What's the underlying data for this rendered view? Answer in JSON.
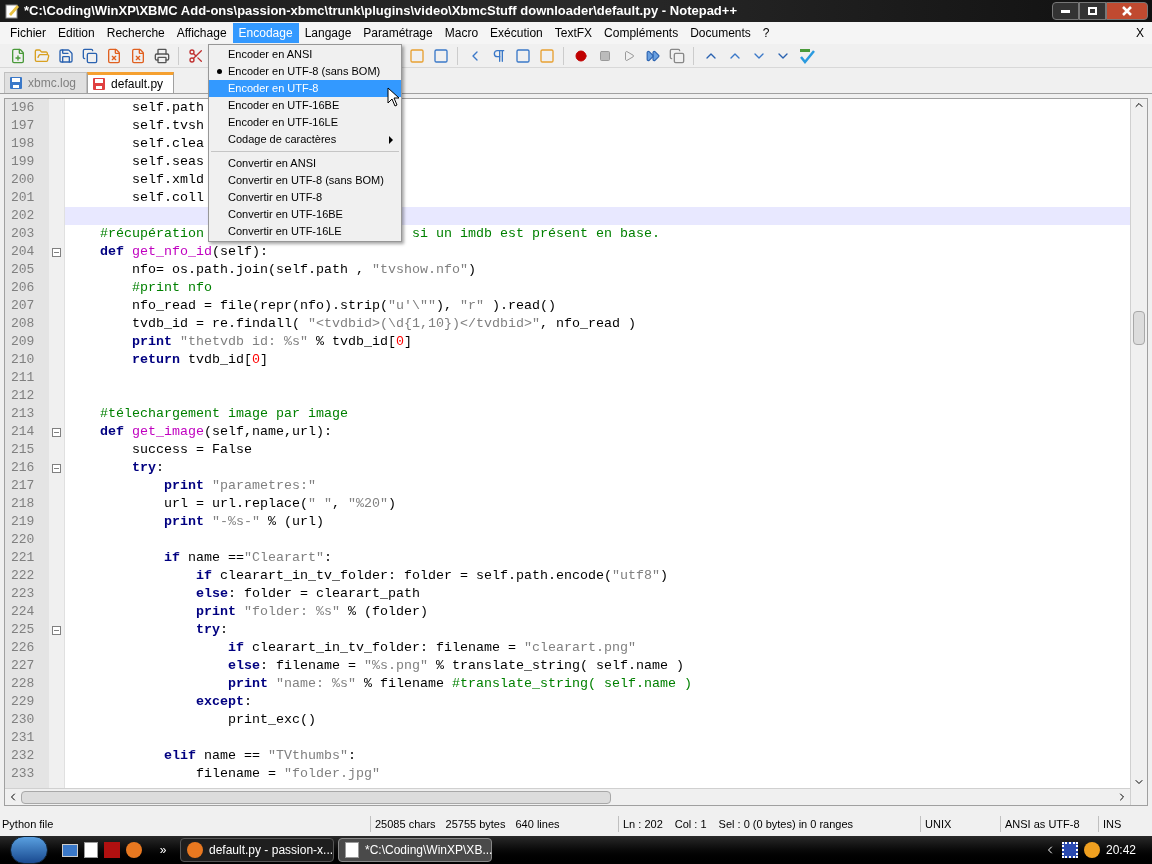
{
  "window": {
    "title": "*C:\\Coding\\WinXP\\XBMC Add-ons\\passion-xbmc\\trunk\\plugins\\video\\XbmcStuff downloader\\default.py - Notepad++"
  },
  "menu_bar": {
    "items": [
      {
        "label": "Fichier",
        "selected": false
      },
      {
        "label": "Edition",
        "selected": false
      },
      {
        "label": "Recherche",
        "selected": false
      },
      {
        "label": "Affichage",
        "selected": false
      },
      {
        "label": "Encodage",
        "selected": true
      },
      {
        "label": "Langage",
        "selected": false
      },
      {
        "label": "Paramétrage",
        "selected": false
      },
      {
        "label": "Macro",
        "selected": false
      },
      {
        "label": "Exécution",
        "selected": false
      },
      {
        "label": "TextFX",
        "selected": false
      },
      {
        "label": "Compléments",
        "selected": false
      },
      {
        "label": "Documents",
        "selected": false
      },
      {
        "label": "?",
        "selected": false
      }
    ],
    "close": "X"
  },
  "dropdown": {
    "items": [
      {
        "kind": "item",
        "label": "Encoder en ANSI",
        "checked": false,
        "selected": false
      },
      {
        "kind": "item",
        "label": "Encoder en UTF-8 (sans BOM)",
        "checked": true,
        "selected": false
      },
      {
        "kind": "item",
        "label": "Encoder en UTF-8",
        "checked": false,
        "selected": true
      },
      {
        "kind": "item",
        "label": "Encoder en UTF-16BE",
        "checked": false,
        "selected": false
      },
      {
        "kind": "item",
        "label": "Encoder en UTF-16LE",
        "checked": false,
        "selected": false
      },
      {
        "kind": "submenu",
        "label": "Codage de caractères",
        "checked": false,
        "selected": false
      },
      {
        "kind": "separator"
      },
      {
        "kind": "item",
        "label": "Convertir en ANSI",
        "checked": false,
        "selected": false
      },
      {
        "kind": "item",
        "label": "Convertir en UTF-8 (sans BOM)",
        "checked": false,
        "selected": false
      },
      {
        "kind": "item",
        "label": "Convertir en UTF-8",
        "checked": false,
        "selected": false
      },
      {
        "kind": "item",
        "label": "Convertir en UTF-16BE",
        "checked": false,
        "selected": false
      },
      {
        "kind": "item",
        "label": "Convertir en UTF-16LE",
        "checked": false,
        "selected": false
      }
    ]
  },
  "tabs": [
    {
      "label": "xbmc.log",
      "selected": false,
      "modified": false
    },
    {
      "label": "default.py",
      "selected": true,
      "modified": true
    }
  ],
  "editor": {
    "lines": [
      {
        "num": "196",
        "current": false,
        "fold": false,
        "tokens": [
          {
            "kind": "plain",
            "text": "        self.path"
          }
        ]
      },
      {
        "num": "197",
        "current": false,
        "fold": false,
        "tokens": [
          {
            "kind": "plain",
            "text": "        self.tvsh"
          }
        ]
      },
      {
        "num": "198",
        "current": false,
        "fold": false,
        "tokens": [
          {
            "kind": "plain",
            "text": "        self.clea"
          }
        ]
      },
      {
        "num": "199",
        "current": false,
        "fold": false,
        "tokens": [
          {
            "kind": "plain",
            "text": "        self.seas"
          }
        ]
      },
      {
        "num": "200",
        "current": false,
        "fold": false,
        "tokens": [
          {
            "kind": "plain",
            "text": "        self.xmld"
          }
        ]
      },
      {
        "num": "201",
        "current": false,
        "fold": false,
        "tokens": [
          {
            "kind": "plain",
            "text": "        self.coll"
          }
        ]
      },
      {
        "num": "202",
        "current": true,
        "fold": false
      },
      {
        "num": "203",
        "current": false,
        "fold": false,
        "tokens": [
          {
            "kind": "cmt",
            "text": "    #récupération"
          },
          {
            "kind": "cmt",
            "text": "                          si un imdb est présent en base."
          }
        ]
      },
      {
        "num": "204",
        "current": false,
        "fold": true,
        "tokens": [
          {
            "kind": "kw",
            "text": "    def "
          },
          {
            "kind": "fn",
            "text": "get_nfo_id"
          },
          {
            "kind": "plain",
            "text": "(self):"
          }
        ]
      },
      {
        "num": "205",
        "current": false,
        "fold": false,
        "tokens": [
          {
            "kind": "plain",
            "text": "        nfo= os.path.join(self.path , "
          },
          {
            "kind": "str",
            "text": "\"tvshow.nfo\""
          },
          {
            "kind": "plain",
            "text": ")"
          }
        ]
      },
      {
        "num": "206",
        "current": false,
        "fold": false,
        "tokens": [
          {
            "kind": "cmt",
            "text": "        #print nfo"
          }
        ]
      },
      {
        "num": "207",
        "current": false,
        "fold": false,
        "tokens": [
          {
            "kind": "plain",
            "text": "        nfo_read = file(repr(nfo).strip("
          },
          {
            "kind": "str",
            "text": "\"u'\\\"\""
          },
          {
            "kind": "plain",
            "text": "), "
          },
          {
            "kind": "str",
            "text": "\"r\""
          },
          {
            "kind": "plain",
            "text": " ).read()"
          }
        ]
      },
      {
        "num": "208",
        "current": false,
        "fold": false,
        "tokens": [
          {
            "kind": "plain",
            "text": "        tvdb_id = re.findall( "
          },
          {
            "kind": "str",
            "text": "\"<tvdbid>(\\d{1,10})</tvdbid>\""
          },
          {
            "kind": "plain",
            "text": ", nfo_read )"
          }
        ]
      },
      {
        "num": "209",
        "current": false,
        "fold": false,
        "tokens": [
          {
            "kind": "kw",
            "text": "        print "
          },
          {
            "kind": "str",
            "text": "\"thetvdb id: %s\""
          },
          {
            "kind": "plain",
            "text": " % tvdb_id["
          },
          {
            "kind": "num",
            "text": "0"
          },
          {
            "kind": "plain",
            "text": "]"
          }
        ]
      },
      {
        "num": "210",
        "current": false,
        "fold": false,
        "tokens": [
          {
            "kind": "kw",
            "text": "        return"
          },
          {
            "kind": "plain",
            "text": " tvdb_id["
          },
          {
            "kind": "num",
            "text": "0"
          },
          {
            "kind": "plain",
            "text": "]"
          }
        ]
      },
      {
        "num": "211",
        "current": false,
        "fold": false
      },
      {
        "num": "212",
        "current": false,
        "fold": false
      },
      {
        "num": "213",
        "current": false,
        "fold": false,
        "tokens": [
          {
            "kind": "cmt",
            "text": "    #télechargement image par image"
          }
        ]
      },
      {
        "num": "214",
        "current": false,
        "fold": true,
        "tokens": [
          {
            "kind": "kw",
            "text": "    def "
          },
          {
            "kind": "fn",
            "text": "get_image"
          },
          {
            "kind": "plain",
            "text": "(self,name,url):"
          }
        ]
      },
      {
        "num": "215",
        "current": false,
        "fold": false,
        "tokens": [
          {
            "kind": "plain",
            "text": "        success = False"
          }
        ]
      },
      {
        "num": "216",
        "current": false,
        "fold": true,
        "tokens": [
          {
            "kind": "kw",
            "text": "        try"
          },
          {
            "kind": "plain",
            "text": ":"
          }
        ]
      },
      {
        "num": "217",
        "current": false,
        "fold": false,
        "tokens": [
          {
            "kind": "kw",
            "text": "            print "
          },
          {
            "kind": "str",
            "text": "\"parametres:\""
          }
        ]
      },
      {
        "num": "218",
        "current": false,
        "fold": false,
        "tokens": [
          {
            "kind": "plain",
            "text": "            url = url.replace("
          },
          {
            "kind": "str",
            "text": "\" \""
          },
          {
            "kind": "plain",
            "text": ", "
          },
          {
            "kind": "str",
            "text": "\"%20\""
          },
          {
            "kind": "plain",
            "text": ")"
          }
        ]
      },
      {
        "num": "219",
        "current": false,
        "fold": false,
        "tokens": [
          {
            "kind": "kw",
            "text": "            print "
          },
          {
            "kind": "str",
            "text": "\"-%s-\""
          },
          {
            "kind": "plain",
            "text": " % (url)"
          }
        ]
      },
      {
        "num": "220",
        "current": false,
        "fold": false
      },
      {
        "num": "221",
        "current": false,
        "fold": false,
        "tokens": [
          {
            "kind": "kw",
            "text": "            if"
          },
          {
            "kind": "plain",
            "text": " name =="
          },
          {
            "kind": "str",
            "text": "\"Clearart\""
          },
          {
            "kind": "plain",
            "text": ":"
          }
        ]
      },
      {
        "num": "222",
        "current": false,
        "fold": false,
        "tokens": [
          {
            "kind": "kw",
            "text": "                if"
          },
          {
            "kind": "plain",
            "text": " clearart_in_tv_folder: folder = self.path.encode("
          },
          {
            "kind": "str",
            "text": "\"utf8\""
          },
          {
            "kind": "plain",
            "text": ")"
          }
        ]
      },
      {
        "num": "223",
        "current": false,
        "fold": false,
        "tokens": [
          {
            "kind": "kw",
            "text": "                else"
          },
          {
            "kind": "plain",
            "text": ": folder = clearart_path"
          }
        ]
      },
      {
        "num": "224",
        "current": false,
        "fold": false,
        "tokens": [
          {
            "kind": "kw",
            "text": "                print "
          },
          {
            "kind": "str",
            "text": "\"folder: %s\""
          },
          {
            "kind": "plain",
            "text": " % (folder)"
          }
        ]
      },
      {
        "num": "225",
        "current": false,
        "fold": true,
        "tokens": [
          {
            "kind": "kw",
            "text": "                try"
          },
          {
            "kind": "plain",
            "text": ":"
          }
        ]
      },
      {
        "num": "226",
        "current": false,
        "fold": false,
        "tokens": [
          {
            "kind": "kw",
            "text": "                    if"
          },
          {
            "kind": "plain",
            "text": " clearart_in_tv_folder: filename = "
          },
          {
            "kind": "str",
            "text": "\"clearart.png\""
          }
        ]
      },
      {
        "num": "227",
        "current": false,
        "fold": false,
        "tokens": [
          {
            "kind": "kw",
            "text": "                    else"
          },
          {
            "kind": "plain",
            "text": ": filename = "
          },
          {
            "kind": "str",
            "text": "\"%s.png\""
          },
          {
            "kind": "plain",
            "text": " % translate_string( self.name )"
          }
        ]
      },
      {
        "num": "228",
        "current": false,
        "fold": false,
        "tokens": [
          {
            "kind": "kw",
            "text": "                    print "
          },
          {
            "kind": "str",
            "text": "\"name: %s\""
          },
          {
            "kind": "plain",
            "text": " % filename "
          },
          {
            "kind": "cmt",
            "text": "#translate_string( self.name )"
          }
        ]
      },
      {
        "num": "229",
        "current": false,
        "fold": false,
        "tokens": [
          {
            "kind": "kw",
            "text": "                except"
          },
          {
            "kind": "plain",
            "text": ":"
          }
        ]
      },
      {
        "num": "230",
        "current": false,
        "fold": false,
        "tokens": [
          {
            "kind": "plain",
            "text": "                    print_exc()"
          }
        ]
      },
      {
        "num": "231",
        "current": false,
        "fold": false
      },
      {
        "num": "232",
        "current": false,
        "fold": false,
        "tokens": [
          {
            "kind": "kw",
            "text": "            elif"
          },
          {
            "kind": "plain",
            "text": " name == "
          },
          {
            "kind": "str",
            "text": "\"TVthumbs\""
          },
          {
            "kind": "plain",
            "text": ":"
          }
        ]
      },
      {
        "num": "233",
        "current": false,
        "fold": false,
        "tokens": [
          {
            "kind": "plain",
            "text": "                filename = "
          },
          {
            "kind": "str",
            "text": "\"folder.jpg\""
          }
        ]
      }
    ]
  },
  "status_bar": {
    "file_type": "Python file",
    "stats": [
      "25085 chars",
      "25755 bytes",
      "640 lines"
    ],
    "position": [
      "Ln : 202",
      "Col : 1",
      "Sel : 0 (0 bytes) in 0 ranges"
    ],
    "eol": "UNIX",
    "encoding": "ANSI as UTF-8",
    "mode": "INS"
  },
  "taskbar": {
    "more": "»",
    "tasks": [
      {
        "label": "default.py - passion-x...",
        "selected": false,
        "kind": "browser"
      },
      {
        "label": "*C:\\Coding\\WinXP\\XB...",
        "selected": true,
        "kind": "editor"
      }
    ],
    "clock": "20:42"
  }
}
